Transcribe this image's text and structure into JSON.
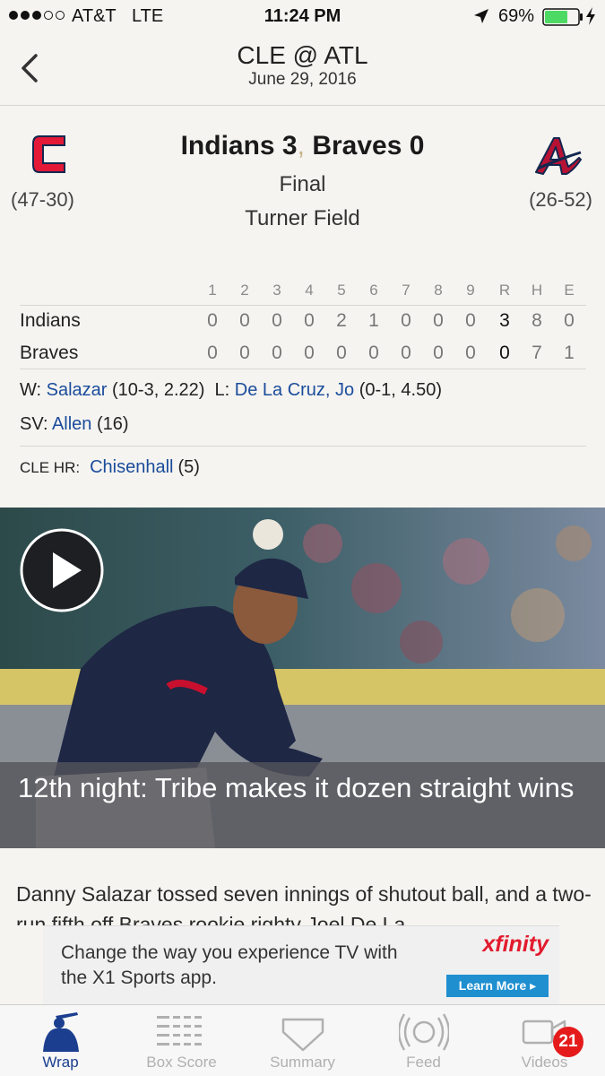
{
  "status_bar": {
    "carrier": "AT&T",
    "network": "LTE",
    "time": "11:24 PM",
    "battery": "69%",
    "battery_level": 0.69,
    "signal_bars_filled": 3,
    "signal_bars_total": 5
  },
  "nav": {
    "title": "CLE @ ATL",
    "date": "June 29, 2016",
    "back_icon": "chevron-left-icon"
  },
  "game": {
    "home_team": {
      "name": "Indians",
      "score": "3",
      "record": "(47-30)",
      "logo": "indians-logo"
    },
    "away_team": {
      "name": "Braves",
      "score": "0",
      "record": "(26-52)",
      "logo": "braves-logo"
    },
    "headline_left": "Indians 3",
    "headline_sep": ",",
    "headline_right": "Braves 0",
    "status": "Final",
    "venue": "Turner Field"
  },
  "linescore": {
    "headers": [
      "1",
      "2",
      "3",
      "4",
      "5",
      "6",
      "7",
      "8",
      "9",
      "R",
      "H",
      "E"
    ],
    "rows": [
      {
        "team": "Indians",
        "values": [
          "0",
          "0",
          "0",
          "0",
          "2",
          "1",
          "0",
          "0",
          "0",
          "3",
          "8",
          "0"
        ]
      },
      {
        "team": "Braves",
        "values": [
          "0",
          "0",
          "0",
          "0",
          "0",
          "0",
          "0",
          "0",
          "0",
          "0",
          "7",
          "1"
        ]
      }
    ]
  },
  "pitchers": {
    "win_label": "W:",
    "win_name": "Salazar",
    "win_stats": "(10-3, 2.22)",
    "loss_label": "L:",
    "loss_name": "De La Cruz, Jo",
    "loss_stats": "(0-1, 4.50)",
    "save_label": "SV:",
    "save_name": "Allen",
    "save_stats": "(16)"
  },
  "home_runs": {
    "label": "CLE HR:",
    "player": "Chisenhall",
    "count": "(5)"
  },
  "hero": {
    "caption": "12th night: Tribe makes it dozen straight wins",
    "play_icon": "play-icon"
  },
  "article": {
    "text": "Danny Salazar tossed seven innings of shutout ball, and a two-run fifth off Braves rookie righty Joel De La"
  },
  "ad": {
    "text": "Change the way you experience TV with the X1 Sports app.",
    "brand": "xfinity",
    "cta": "Learn More ▸"
  },
  "tabs": [
    {
      "label": "Wrap",
      "icon": "batter-icon",
      "active": true
    },
    {
      "label": "Box Score",
      "icon": "box-score-icon",
      "active": false
    },
    {
      "label": "Summary",
      "icon": "home-plate-icon",
      "active": false
    },
    {
      "label": "Feed",
      "icon": "feed-ball-icon",
      "active": false
    },
    {
      "label": "Videos",
      "icon": "video-camera-icon",
      "active": false,
      "badge": "21"
    }
  ],
  "colors": {
    "link": "#1b4c9c",
    "indians_red": "#e31937",
    "braves_navy": "#13274f",
    "tab_active": "#1b3e8f",
    "badge_red": "#e51b1b",
    "background": "#f5f4f0"
  }
}
